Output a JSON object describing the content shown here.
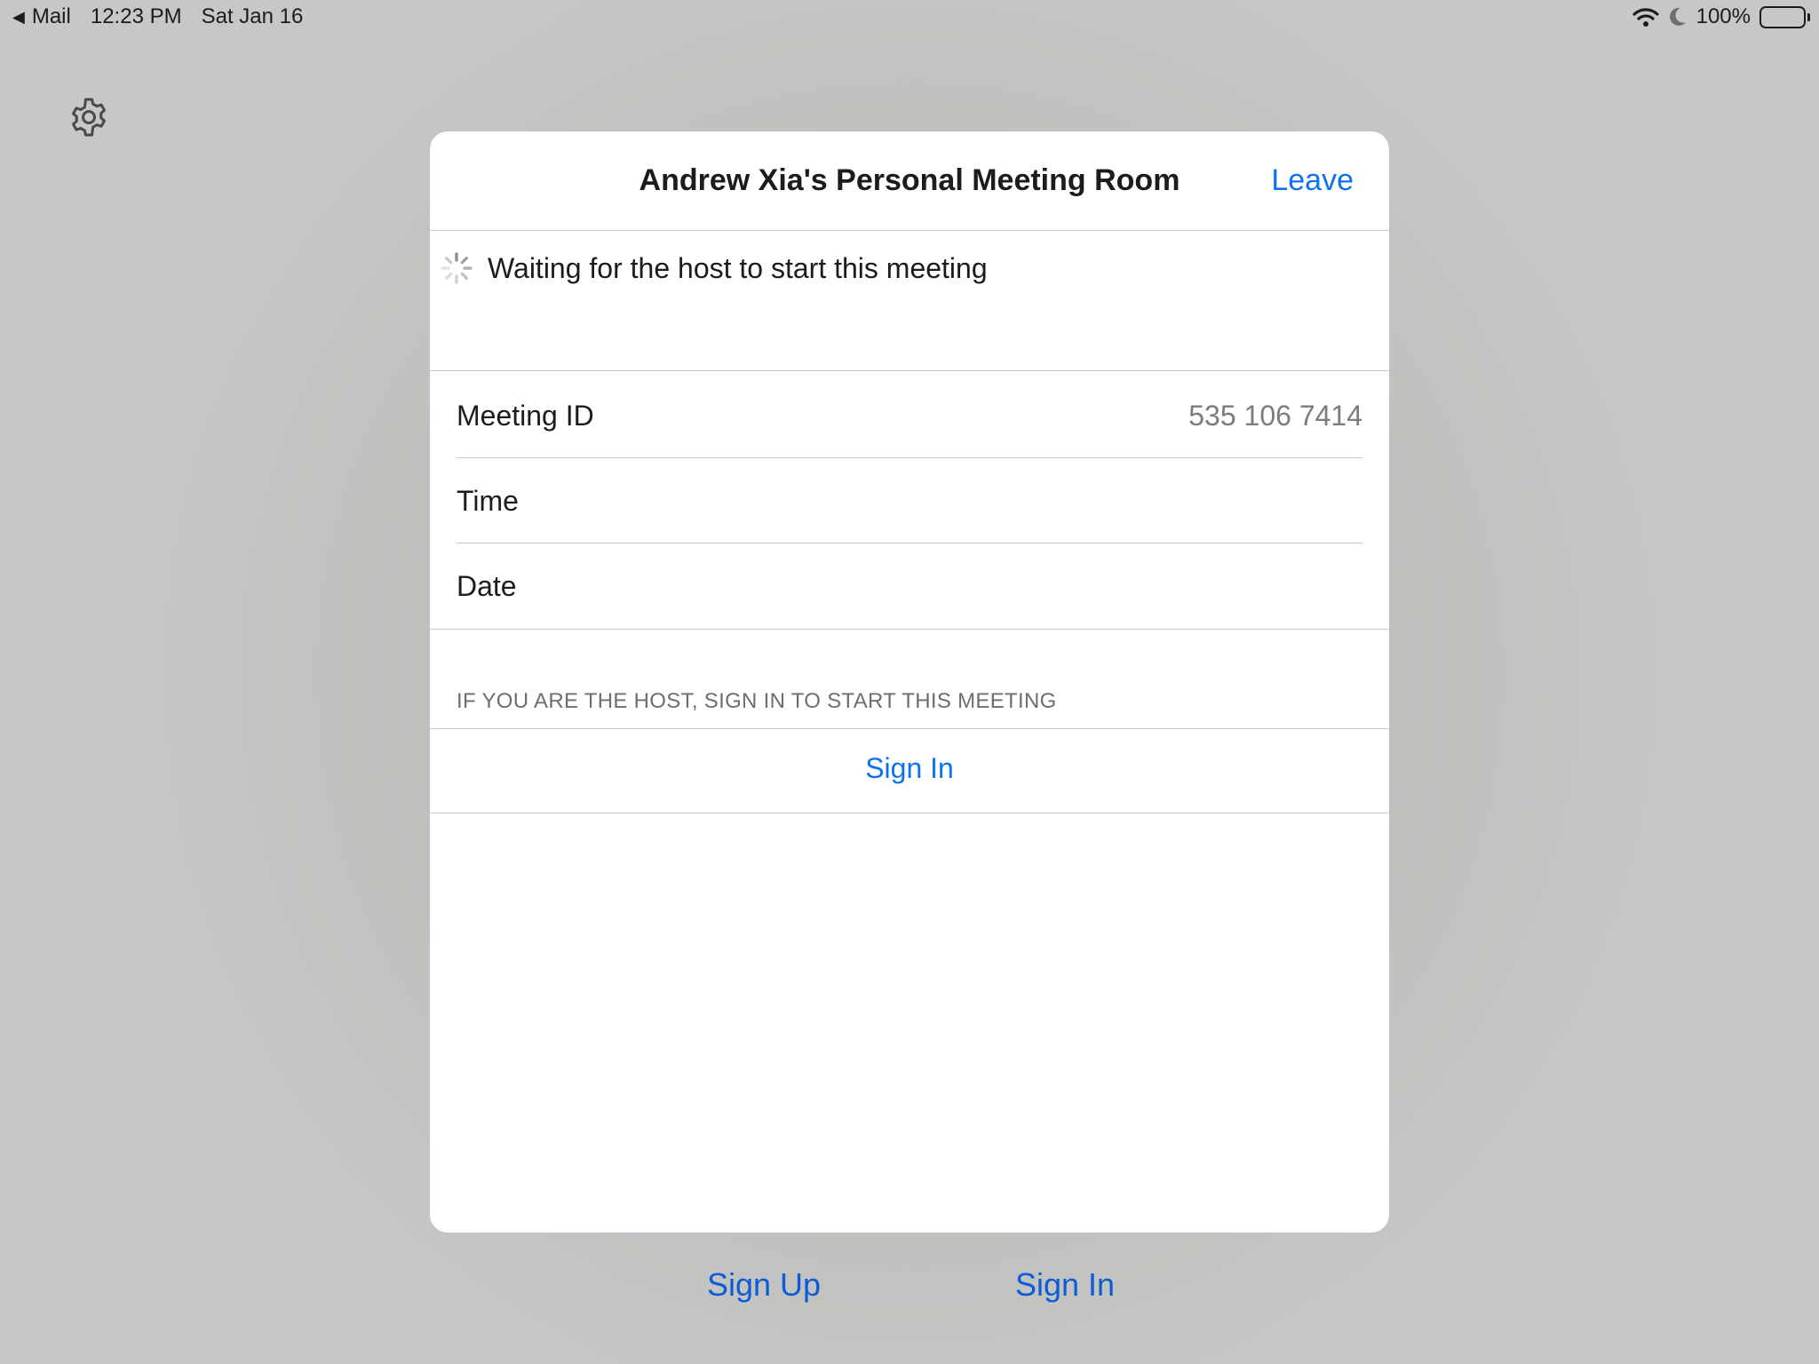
{
  "status_bar": {
    "back_app": "Mail",
    "time": "12:23 PM",
    "date": "Sat Jan 16",
    "battery": "100%"
  },
  "icons": {
    "settings": "gear-icon",
    "loading": "spinner-icon",
    "wifi": "wifi-icon",
    "do_not_disturb": "moon-icon",
    "battery": "battery-icon"
  },
  "modal": {
    "title": "Andrew Xia's Personal Meeting Room",
    "leave_label": "Leave",
    "waiting_text": "Waiting for the host to start this meeting",
    "rows": [
      {
        "label": "Meeting ID",
        "value": "535 106 7414"
      },
      {
        "label": "Time",
        "value": ""
      },
      {
        "label": "Date",
        "value": ""
      }
    ],
    "host_hint": "IF YOU ARE THE HOST, SIGN IN TO START THIS MEETING",
    "sign_in_label": "Sign In"
  },
  "bottom": {
    "sign_up_label": "Sign Up",
    "sign_in_label": "Sign In"
  },
  "colors": {
    "accent": "#0e72ed",
    "bottom_link": "#0b5cd6",
    "background": "#c6c6c4"
  }
}
